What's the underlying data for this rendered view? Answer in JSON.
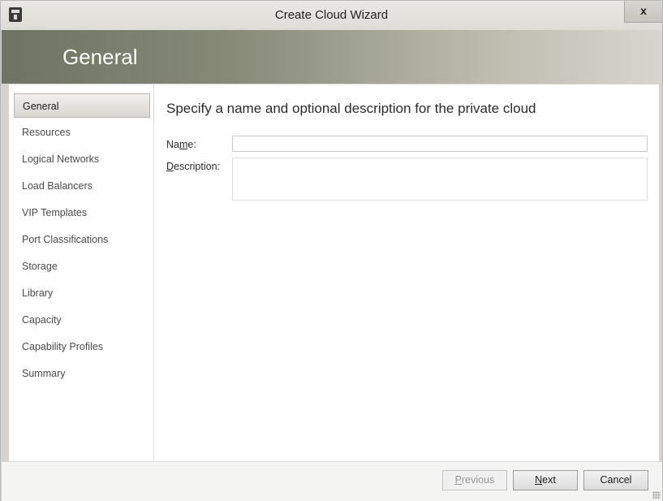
{
  "window": {
    "title": "Create Cloud Wizard",
    "close_label": "x",
    "icon": "wizard-app-icon"
  },
  "header": {
    "title": "General"
  },
  "sidebar": {
    "items": [
      {
        "label": "General",
        "active": true
      },
      {
        "label": "Resources",
        "active": false
      },
      {
        "label": "Logical Networks",
        "active": false
      },
      {
        "label": "Load Balancers",
        "active": false
      },
      {
        "label": "VIP Templates",
        "active": false
      },
      {
        "label": "Port Classifications",
        "active": false
      },
      {
        "label": "Storage",
        "active": false
      },
      {
        "label": "Library",
        "active": false
      },
      {
        "label": "Capacity",
        "active": false
      },
      {
        "label": "Capability Profiles",
        "active": false
      },
      {
        "label": "Summary",
        "active": false
      }
    ]
  },
  "main": {
    "heading": "Specify a name and optional description for the private cloud",
    "name": {
      "label_pre": "Na",
      "label_key": "m",
      "label_post": "e:",
      "value": ""
    },
    "description": {
      "label_pre": "",
      "label_key": "D",
      "label_post": "escription:",
      "value": ""
    }
  },
  "footer": {
    "previous": {
      "pre": "",
      "key": "P",
      "post": "revious",
      "enabled": false
    },
    "next": {
      "pre": "",
      "key": "N",
      "post": "ext",
      "enabled": true
    },
    "cancel": {
      "label": "Cancel",
      "enabled": true
    }
  },
  "colors": {
    "header_gradient_start": "#6f7363",
    "header_gradient_end": "#d8d6cf",
    "active_nav_bg": "#e4e2dd"
  }
}
